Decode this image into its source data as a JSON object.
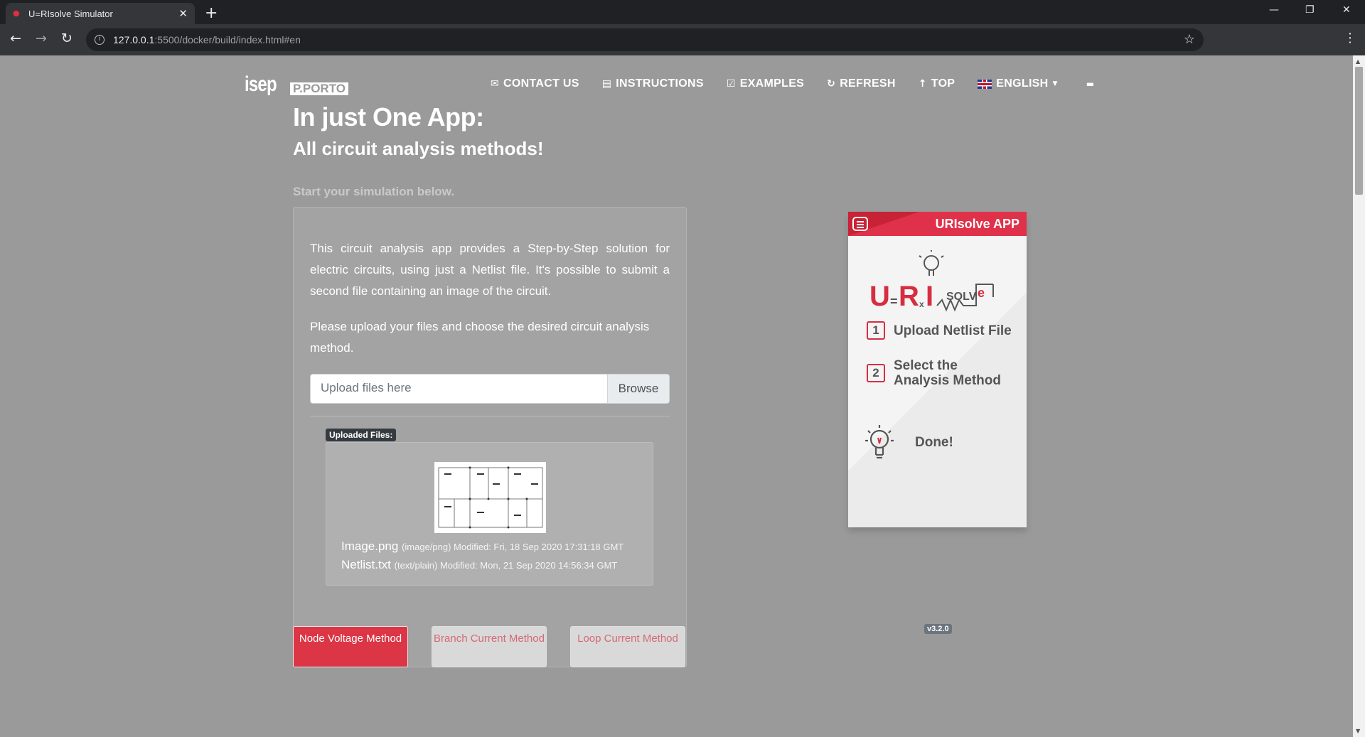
{
  "browser": {
    "tab_title": "U=RIsolve Simulator",
    "url_host": "127.0.0.1",
    "url_path": ":5500/docker/build/index.html#en"
  },
  "logos": {
    "isep": "isep",
    "porto": "P.PORTO"
  },
  "nav": {
    "contact": "CONTACT US",
    "instructions": "INSTRUCTIONS",
    "examples": "EXAMPLES",
    "refresh": "REFRESH",
    "top": "TOP",
    "language": "ENGLISH"
  },
  "hero": {
    "title": "In just One App:",
    "subtitle": "All circuit analysis methods!",
    "start": "Start your simulation below."
  },
  "card": {
    "description": "This circuit analysis app provides a Step-by-Step solution for electric circuits, using just a Netlist file. It's possible to submit a second file containing an image of the circuit.",
    "instruction": "Please upload your files and choose the desired circuit analysis method.",
    "upload_placeholder": "Upload files here",
    "browse_label": "Browse",
    "uploaded_badge": "Uploaded Files:",
    "files": [
      {
        "name": "Image.png",
        "meta": "(image/png) Modified: Fri, 18 Sep 2020 17:31:18 GMT"
      },
      {
        "name": "Netlist.txt",
        "meta": "(text/plain) Modified: Mon, 21 Sep 2020 14:56:34 GMT"
      }
    ]
  },
  "methods": {
    "node_voltage": "Node Voltage Method",
    "branch_current": "Branch Current Method",
    "loop_current": "Loop Current Method"
  },
  "phone": {
    "title": "URIsolve APP",
    "logo_text": "U=R×I SOLVE",
    "step1_num": "1",
    "step1": "Upload Netlist File",
    "step2_num": "2",
    "step2": "Select the Analysis Method",
    "step3": "Done!"
  },
  "version": "v3.2.0",
  "colors": {
    "accent": "#dc3545",
    "page_bg": "#9a9a9a"
  }
}
